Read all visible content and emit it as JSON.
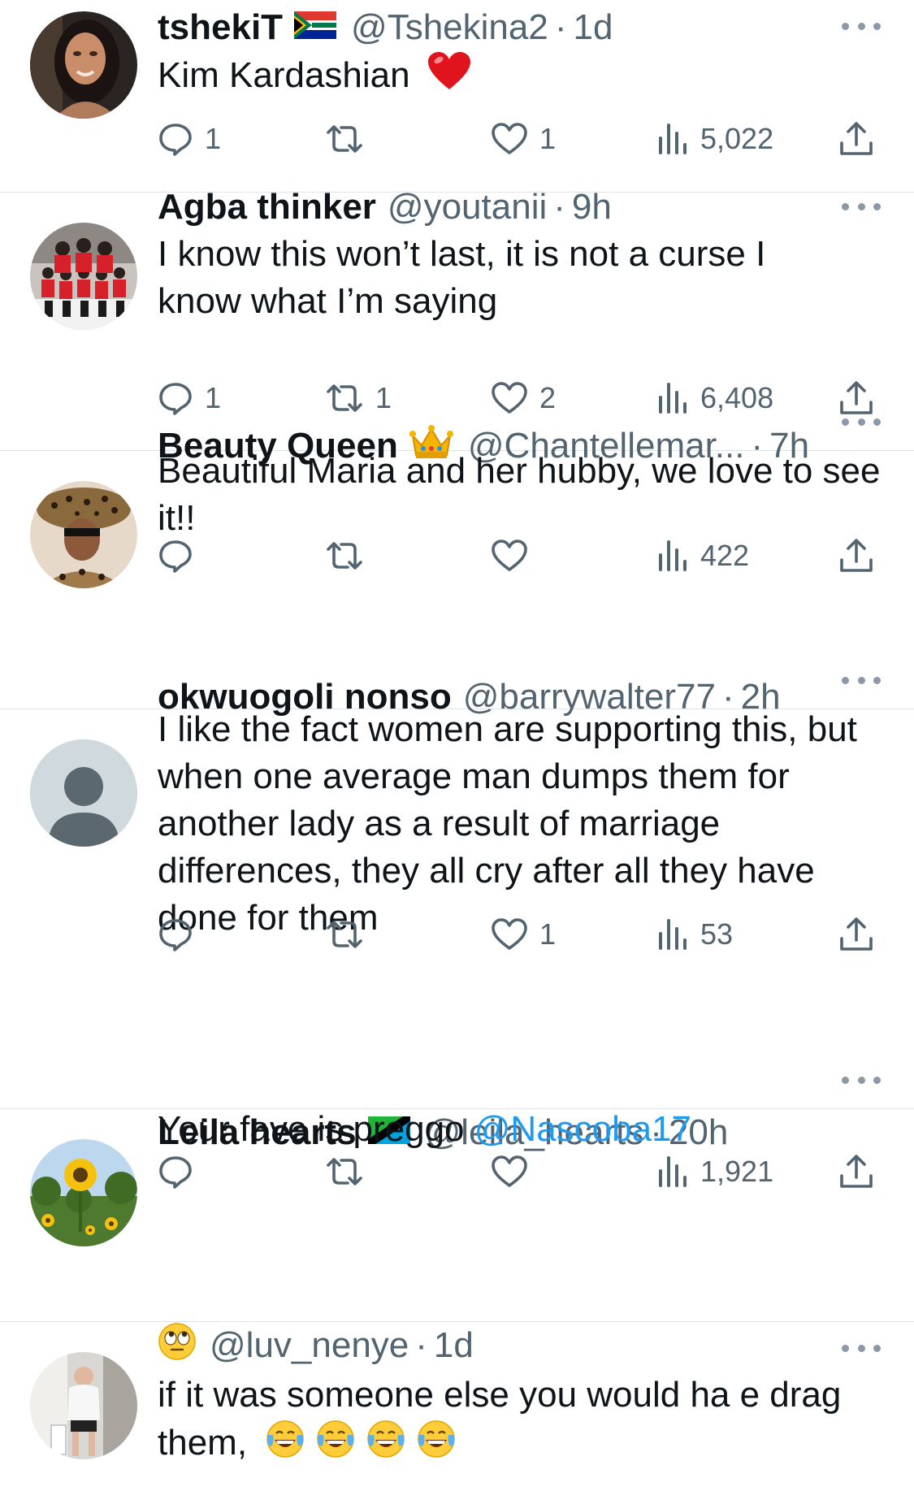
{
  "replies": [
    {
      "name": "tshekiT",
      "flag": "south-africa-flag",
      "handle": "@Tshekina2",
      "time": "1d",
      "text": "Kim Kardashian",
      "text_emoji": "red-heart-emoji",
      "comments": "1",
      "retweets": "",
      "likes": "1",
      "views": "5,022"
    },
    {
      "name": "Agba thinker",
      "handle": "@youtanii",
      "time": "9h",
      "text": "I know this won’t last, it is not a curse I know what I’m saying",
      "comments": "1",
      "retweets": "1",
      "likes": "2",
      "views": "6,408"
    },
    {
      "name": "Beauty Queen",
      "flag": "crown-emoji",
      "handle": "@Chantellemar...",
      "time": "7h",
      "text": "Beautiful Maria and her hubby, we love to see it!!",
      "comments": "",
      "retweets": "",
      "likes": "",
      "views": "422"
    },
    {
      "name": "okwuogoli nonso",
      "handle": "@barrywalter77",
      "time": "2h",
      "text": "I like the fact women are supporting this, but when one average man dumps them for another lady as a result of marriage differences, they all cry after all they have done for them",
      "comments": "",
      "retweets": "",
      "likes": "1",
      "views": "53"
    },
    {
      "name": "Leila hearts",
      "flag": "tanzania-flag",
      "handle": "@leila_hearts",
      "time": "20h",
      "text": "Your fave is preggo ",
      "mention": "@Nascoba17",
      "comments": "",
      "retweets": "",
      "likes": "",
      "views": "1,921"
    },
    {
      "name": "",
      "flag": "rolling-eyes-emoji",
      "handle": "@luv_nenye",
      "time": "1d",
      "text": "if it was someone else you would ha e drag them,",
      "text_emoji": "laughing-tears-emoji x4"
    }
  ],
  "dot_separator": "·",
  "colors": {
    "text": "#0f1419",
    "secondary": "#536471",
    "link": "#1d9bf0",
    "divider": "#dfe3e7"
  }
}
